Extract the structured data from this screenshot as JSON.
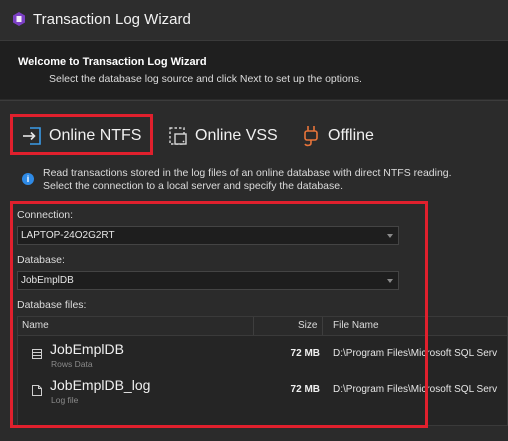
{
  "window": {
    "title": "Transaction Log Wizard"
  },
  "header": {
    "title": "Welcome to Transaction Log Wizard",
    "subtitle": "Select the database log source and click Next to set up the options."
  },
  "modes": [
    {
      "label": "Online NTFS",
      "icon": "login-arrow-icon",
      "selected": true
    },
    {
      "label": "Online VSS",
      "icon": "disk-snapshot-icon",
      "selected": false
    },
    {
      "label": "Offline",
      "icon": "plug-icon",
      "selected": false
    }
  ],
  "info": {
    "line1": "Read transactions stored in the log files of an online database with direct NTFS reading.",
    "line2": "Select the connection to a local server and specify the database."
  },
  "connection": {
    "label": "Connection:",
    "value": "LAPTOP-24O2G2RT"
  },
  "database": {
    "label": "Database:",
    "value": "JobEmplDB"
  },
  "files": {
    "label": "Database files:",
    "columns": {
      "name": "Name",
      "size": "Size",
      "file_name": "File Name"
    },
    "rows": [
      {
        "name": "JobEmplDB",
        "type": "Rows Data",
        "size": "72 MB",
        "file_name": "D:\\Program Files\\Microsoft SQL Serv"
      },
      {
        "name": "JobEmplDB_log",
        "type": "Log file",
        "size": "72 MB",
        "file_name": "D:\\Program Files\\Microsoft SQL Serv"
      }
    ]
  },
  "colors": {
    "highlight": "#e0202d",
    "accent": "#2e8ae6",
    "background": "#2b2b2b"
  }
}
